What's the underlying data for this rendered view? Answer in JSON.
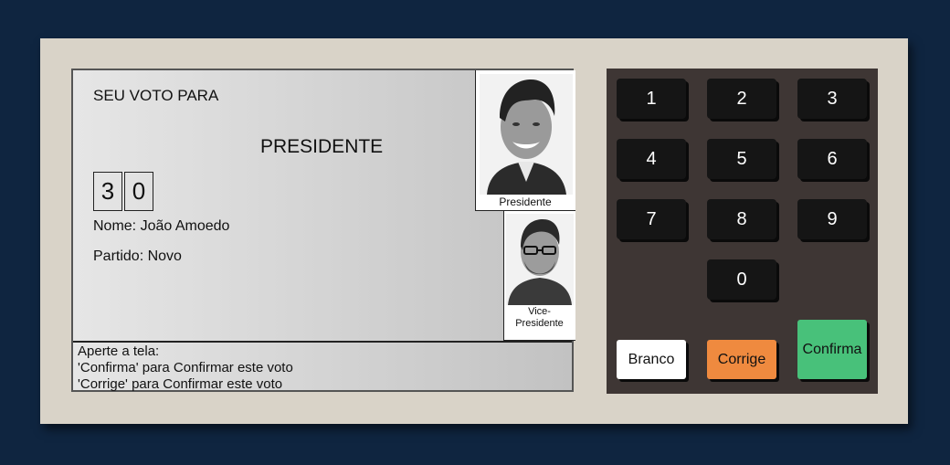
{
  "screen": {
    "vote_for": "SEU VOTO PARA",
    "office": "PRESIDENTE",
    "digits": [
      "3",
      "0"
    ],
    "name_line": "Nome: João Amoedo",
    "party_line": "Partido: Novo",
    "photo_president_caption": "Presidente",
    "photo_vice_caption_1": "Vice-",
    "photo_vice_caption_2": "Presidente",
    "instructions": {
      "line1": "Aperte a tela:",
      "line2": "'Confirma' para Confirmar este voto",
      "line3": "'Corrige' para Confirmar este voto"
    }
  },
  "keypad": {
    "keys": [
      "1",
      "2",
      "3",
      "4",
      "5",
      "6",
      "7",
      "8",
      "9",
      "0"
    ],
    "branco": "Branco",
    "corrige": "Corrige",
    "confirma": "Confirma"
  },
  "colors": {
    "background": "#0f2540",
    "machine": "#d9d3c8",
    "keypad_panel": "#3e3634",
    "key": "#151515",
    "branco": "#ffffff",
    "corrige": "#ef8a3f",
    "confirma": "#48c17a"
  }
}
